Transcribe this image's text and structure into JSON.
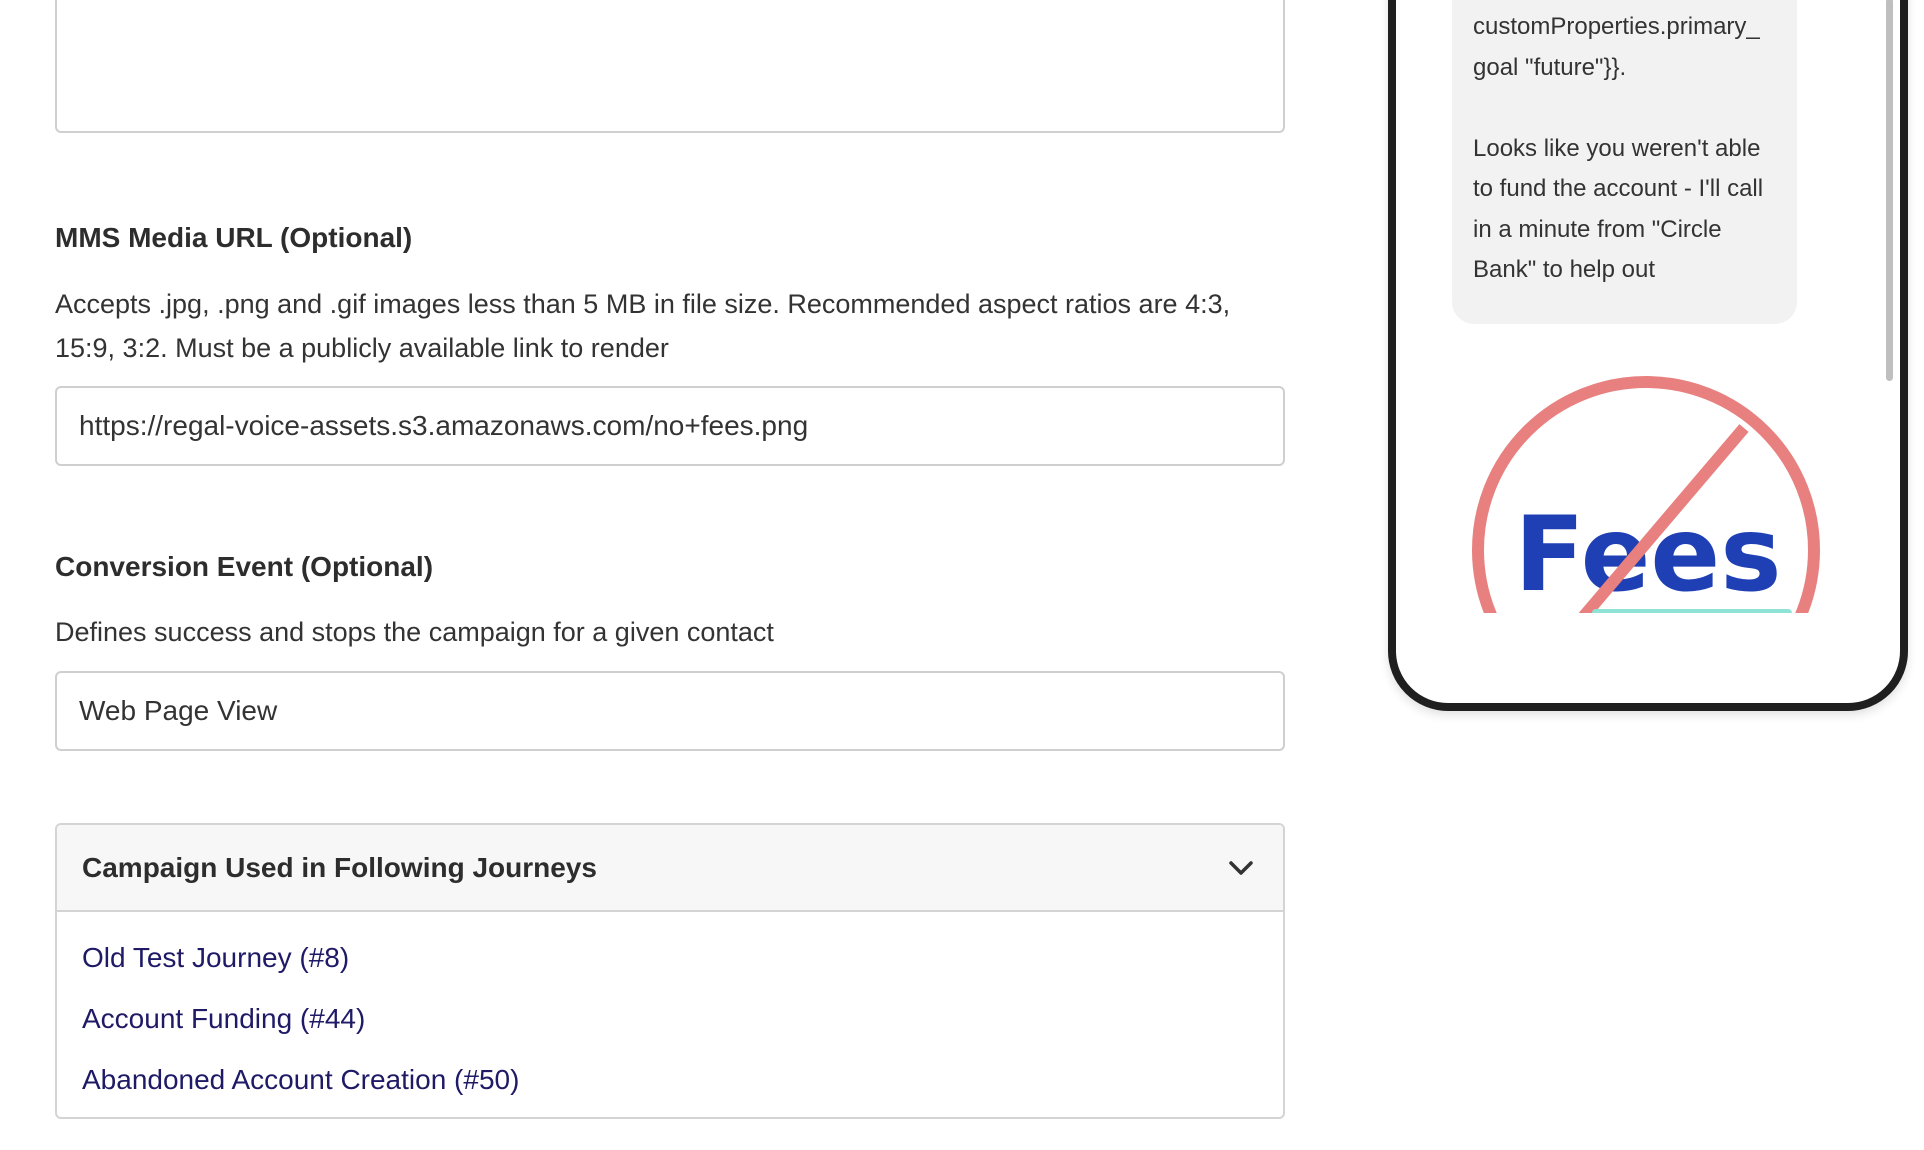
{
  "form": {
    "mms": {
      "label": "MMS Media URL (Optional)",
      "help": "Accepts .jpg, .png and .gif images less than 5 MB in file size. Recommended aspect ratios are 4:3, 15:9, 3:2. Must be a publicly available link to render",
      "value": "https://regal-voice-assets.s3.amazonaws.com/no+fees.png"
    },
    "conversion": {
      "label": "Conversion Event (Optional)",
      "help": "Defines success and stops the campaign for a given contact",
      "value": "Web Page View"
    },
    "journeys": {
      "title": "Campaign Used in Following Journeys",
      "items": [
        "Old Test Journey (#8)",
        "Account Funding (#44)",
        "Abandoned Account Creation (#50)"
      ]
    }
  },
  "preview": {
    "message_partial": "{{default\ncustomProperties.primary_\ngoal \"future\"}}.\n\nLooks like you weren't able\nto fund the account - I'll call\nin a minute from \"Circle\nBank\" to help out",
    "image_text": "Fees",
    "colors": {
      "prohibition": "#e88080",
      "fees_text": "#1f3fb5",
      "underline": "#8fe3d6"
    }
  }
}
